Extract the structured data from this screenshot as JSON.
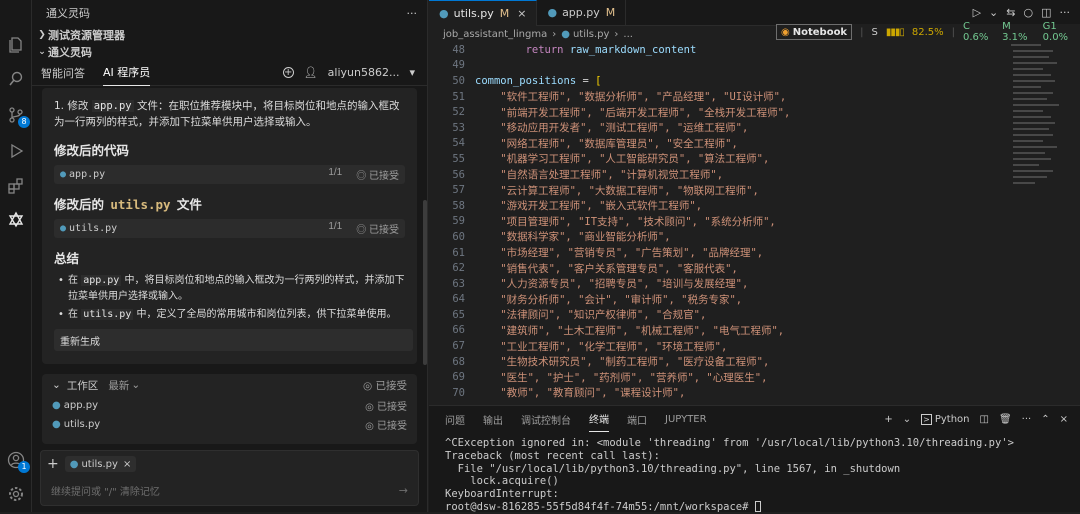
{
  "sidebar": {
    "title": "通义灵码",
    "more": "···",
    "section1": "测试资源管理器",
    "section2": "通义灵码",
    "tabs": [
      "智能问答",
      "AI 程序员"
    ],
    "user": "aliyun5862...",
    "add_icon": "+",
    "chat": {
      "step_num": "1. 修改 ",
      "step_file": "app.py",
      "step_text": " 文件：在职位推荐模块中，将目标岗位和地点的输入框改为一行两列的样式，并添加下拉菜单供用户选择或输入。",
      "h_code": "修改后的代码",
      "file1": {
        "name": "app.py",
        "count": "1/1",
        "status": "已接受"
      },
      "h_utils_pre": "修改后的 ",
      "h_utils_code": "utils.py",
      "h_utils_post": " 文件",
      "file2": {
        "name": "utils.py",
        "count": "1/1",
        "status": "已接受"
      },
      "h_summary": "总结",
      "bullet1_pre": "在 ",
      "bullet1_code": "app.py",
      "bullet1_post": " 中，将目标岗位和地点的输入框改为一行两列的样式，并添加下拉菜单供用户选择或输入。",
      "bullet2_pre": "在 ",
      "bullet2_code": "utils.py",
      "bullet2_post": " 中，定义了全局的常用城市和岗位列表，供下拉菜单使用。",
      "regen": "重新生成"
    },
    "work": {
      "title": "工作区",
      "filter": "最新",
      "status": "已接受",
      "files": [
        {
          "name": "app.py",
          "status": "已接受"
        },
        {
          "name": "utils.py",
          "status": "已接受"
        }
      ]
    },
    "input": {
      "chip": "utils.py",
      "placeholder": "继续提问或 \"/\" 清除记忆"
    }
  },
  "editor": {
    "tabs": [
      {
        "name": "utils.py",
        "mark": "M"
      },
      {
        "name": "app.py",
        "mark": "M"
      }
    ],
    "breadcrumb": [
      "job_assistant_lingma",
      "utils.py",
      "..."
    ],
    "notebook": {
      "label": "Notebook",
      "s": "S",
      "s_val": "82.5%",
      "c": "C 0.6%",
      "m": "M 3.1%",
      "g": "G1 0.0%"
    },
    "lines": [
      {
        "n": "48",
        "t": "        return raw_markdown_content"
      },
      {
        "n": "49",
        "t": ""
      },
      {
        "n": "50",
        "t": "common_positions = ["
      },
      {
        "n": "51",
        "t": "    \"软件工程师\", \"数据分析师\", \"产品经理\", \"UI设计师\","
      },
      {
        "n": "52",
        "t": "    \"前端开发工程师\", \"后端开发工程师\", \"全栈开发工程师\","
      },
      {
        "n": "53",
        "t": "    \"移动应用开发者\", \"测试工程师\", \"运维工程师\","
      },
      {
        "n": "54",
        "t": "    \"网络工程师\", \"数据库管理员\", \"安全工程师\","
      },
      {
        "n": "55",
        "t": "    \"机器学习工程师\", \"人工智能研究员\", \"算法工程师\","
      },
      {
        "n": "56",
        "t": "    \"自然语言处理工程师\", \"计算机视觉工程师\","
      },
      {
        "n": "57",
        "t": "    \"云计算工程师\", \"大数据工程师\", \"物联网工程师\","
      },
      {
        "n": "58",
        "t": "    \"游戏开发工程师\", \"嵌入式软件工程师\","
      },
      {
        "n": "59",
        "t": "    \"项目管理师\", \"IT支持\", \"技术顾问\", \"系统分析师\","
      },
      {
        "n": "60",
        "t": "    \"数据科学家\", \"商业智能分析师\","
      },
      {
        "n": "61",
        "t": "    \"市场经理\", \"营销专员\", \"广告策划\", \"品牌经理\","
      },
      {
        "n": "62",
        "t": "    \"销售代表\", \"客户关系管理专员\", \"客服代表\","
      },
      {
        "n": "63",
        "t": "    \"人力资源专员\", \"招聘专员\", \"培训与发展经理\","
      },
      {
        "n": "64",
        "t": "    \"财务分析师\", \"会计\", \"审计师\", \"税务专家\","
      },
      {
        "n": "65",
        "t": "    \"法律顾问\", \"知识产权律师\", \"合规官\","
      },
      {
        "n": "66",
        "t": "    \"建筑师\", \"土木工程师\", \"机械工程师\", \"电气工程师\","
      },
      {
        "n": "67",
        "t": "    \"工业工程师\", \"化学工程师\", \"环境工程师\","
      },
      {
        "n": "68",
        "t": "    \"生物技术研究员\", \"制药工程师\", \"医疗设备工程师\","
      },
      {
        "n": "69",
        "t": "    \"医生\", \"护士\", \"药剂师\", \"营养师\", \"心理医生\","
      },
      {
        "n": "70",
        "t": "    \"教师\", \"教育顾问\", \"课程设计师\","
      }
    ]
  },
  "panel": {
    "tabs": [
      "问题",
      "输出",
      "调试控制台",
      "终端",
      "端口",
      "JUPYTER"
    ],
    "active": "终端",
    "shell": "Python",
    "terminal": [
      "^CException ignored in: <module 'threading' from '/usr/local/lib/python3.10/threading.py'>",
      "Traceback (most recent call last):",
      "  File \"/usr/local/lib/python3.10/threading.py\", line 1567, in _shutdown",
      "    lock.acquire()",
      "KeyboardInterrupt:",
      "root@dsw-816285-55f5d84f4f-74m55:/mnt/workspace# "
    ]
  },
  "activity_badge": "8"
}
